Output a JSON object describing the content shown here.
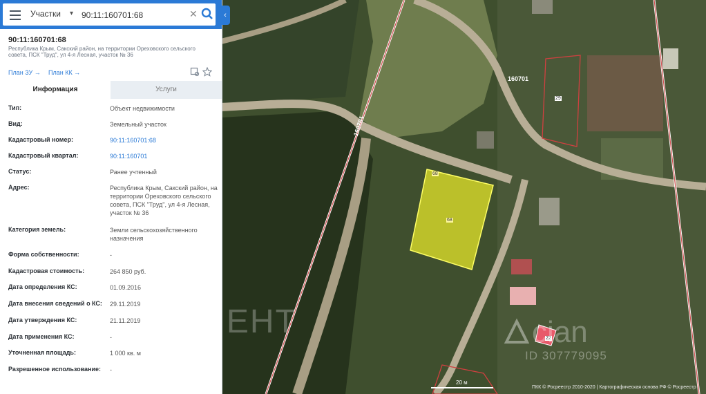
{
  "search": {
    "type": "Участки",
    "value": "90:11:160701:68"
  },
  "object": {
    "title": "90:11:160701:68",
    "address": "Республика Крым, Сакский район, на территории Ореховского сельского совета, ПСК \"Труд\", ул 4-я Лесная, участок № 36",
    "links": [
      "План ЗУ →",
      "План КК →"
    ]
  },
  "tabs": [
    "Информация",
    "Услуги"
  ],
  "rows": [
    {
      "label": "Тип:",
      "value": "Объект недвижимости"
    },
    {
      "label": "Вид:",
      "value": "Земельный участок"
    },
    {
      "label": "Кадастровый номер:",
      "value": "90:11:160701:68"
    },
    {
      "label": "Кадастровый квартал:",
      "value": "90:11:160701"
    },
    {
      "label": "Статус:",
      "value": "Ранее учтенный"
    },
    {
      "label": "Адрес:",
      "value": "Республика Крым, Сакский район, на территории Ореховского сельского совета, ПСК \"Труд\", ул 4-я Лесная, участок № 36"
    },
    {
      "label": "Категория земель:",
      "value": "Земли сельскохозяйственного назначения"
    },
    {
      "label": "Форма собственности:",
      "value": "-"
    },
    {
      "label": "Кадастровая стоимость:",
      "value": "264 850 руб."
    },
    {
      "label": "Дата определения КС:",
      "value": "01.09.2016"
    },
    {
      "label": "Дата внесения сведений о КС:",
      "value": "29.11.2019"
    },
    {
      "label": "Дата утверждения КС:",
      "value": "21.11.2019"
    },
    {
      "label": "Дата применения КС:",
      "value": "-"
    },
    {
      "label": "Уточненная площадь:",
      "value": "1 000 кв. м"
    },
    {
      "label": "Разрешенное использование:",
      "value": "-"
    }
  ],
  "map": {
    "quarter_labels": [
      "160701",
      "160701"
    ],
    "plot_labels": [
      "68",
      "68",
      "29",
      "22"
    ],
    "scale": "20 м",
    "copyright": "ПКК © Росреестр 2010-2020 | Картографическая основа РФ © Росреестр",
    "watermark_text": "КОНТИНЕНТ",
    "watermark_brand": "cian",
    "watermark_id": "ID 307779095",
    "accent_color": "#2b7ad6",
    "plot_fill_color": "#e6e629"
  }
}
